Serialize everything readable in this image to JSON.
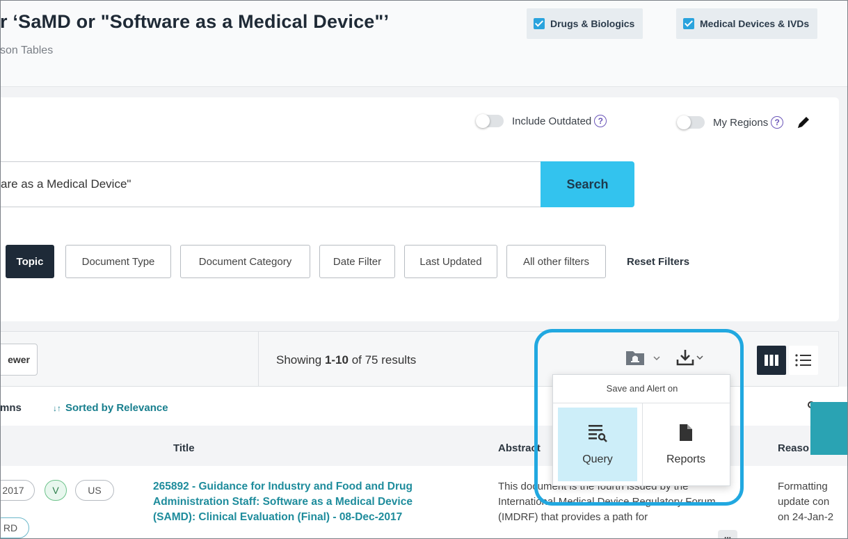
{
  "header": {
    "title": "r ‘SaMD or \"Software as a Medical Device\"’",
    "subtitle": "son Tables",
    "checks": [
      {
        "label": "Drugs & Biologics",
        "checked": true
      },
      {
        "label": "Medical Devices & IVDs",
        "checked": true
      }
    ]
  },
  "search": {
    "include_outdated_label": "Include Outdated",
    "my_regions_label": "My Regions",
    "help_glyph": "?",
    "query_text": "are as a Medical Device\"",
    "search_button": "Search"
  },
  "filters": {
    "items": [
      "Topic",
      "Document Type",
      "Document Category",
      "Date Filter",
      "Last Updated",
      "All other filters"
    ],
    "active": "Topic",
    "reset_label": "Reset Filters"
  },
  "results": {
    "viewer_label": "ewer",
    "showing_prefix": "Showing ",
    "showing_range": "1-10",
    "showing_suffix": " of 75 results",
    "columns_label": "mns",
    "sorted_label": "Sorted by Relevance",
    "sort_icon": "↓↑"
  },
  "save_popup": {
    "title": "Save and Alert on",
    "query_label": "Query",
    "reports_label": "Reports"
  },
  "table": {
    "headers": {
      "title": "Title",
      "abstract": "Abstract",
      "reason": "Reaso"
    },
    "row1": {
      "pills": [
        "2017",
        "V",
        "US"
      ],
      "pill2": "RD",
      "title": "265892 - Guidance for Industry and Food and Drug Administration Staff: Software as a Medical Device (SAMD): Clinical Evaluation (Final) - 08-Dec-2017",
      "abstract": "This document is the fourth issued by the International Medical Device Regulatory Forum (IMDRF) that provides a path for",
      "reason_lines": [
        "Formatting",
        "update con",
        "on 24-Jan-2"
      ],
      "more": "..."
    }
  },
  "colors": {
    "accent": "#33c3ee",
    "dark": "#1e2a38",
    "teal_link": "#1e8c9c",
    "highlight_ring": "#21a8e0"
  }
}
